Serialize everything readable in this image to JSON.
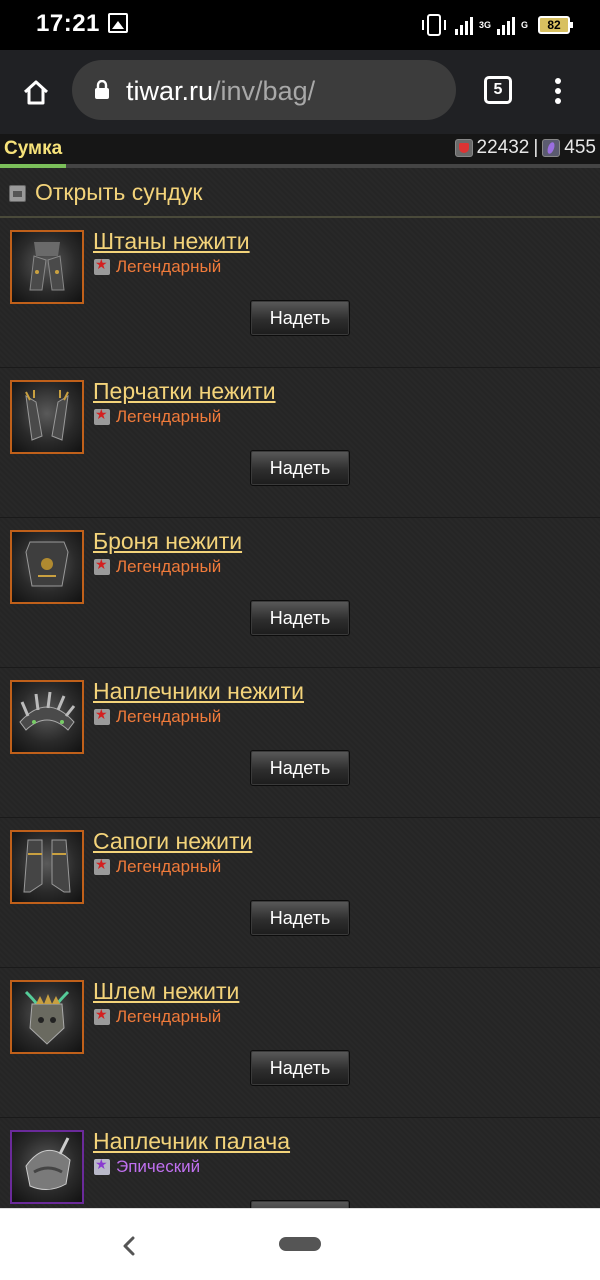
{
  "status_bar": {
    "time": "17:21",
    "network_1": "3G",
    "network_2": "G",
    "battery": "82"
  },
  "browser": {
    "url_domain": "tiwar.ru",
    "url_path": "/inv/bag/",
    "tab_count": "5"
  },
  "header": {
    "title": "Сумка",
    "gold": "22432",
    "separator": "|",
    "crystals": "455",
    "progress_fraction": 0.11
  },
  "chest": {
    "label": "Открыть сундук"
  },
  "equip_label": "Надеть",
  "items": [
    {
      "name": "Штаны нежити",
      "rarity": "Легендарный",
      "tier": "legendary",
      "icon": "legs-armor-icon"
    },
    {
      "name": "Перчатки нежити",
      "rarity": "Легендарный",
      "tier": "legendary",
      "icon": "gloves-icon"
    },
    {
      "name": "Броня нежити",
      "rarity": "Легендарный",
      "tier": "legendary",
      "icon": "chest-armor-icon"
    },
    {
      "name": "Наплечники нежити",
      "rarity": "Легендарный",
      "tier": "legendary",
      "icon": "shoulders-icon"
    },
    {
      "name": "Сапоги нежити",
      "rarity": "Легендарный",
      "tier": "legendary",
      "icon": "boots-icon"
    },
    {
      "name": "Шлем нежити",
      "rarity": "Легендарный",
      "tier": "legendary",
      "icon": "helmet-icon"
    },
    {
      "name": "Наплечник палача",
      "rarity": "Эпический",
      "tier": "epic",
      "icon": "shoulder-icon"
    }
  ],
  "colors": {
    "legendary": "#f07a3a",
    "epic": "#c070f0",
    "link": "#f3d37a",
    "title": "#f6e27a"
  }
}
